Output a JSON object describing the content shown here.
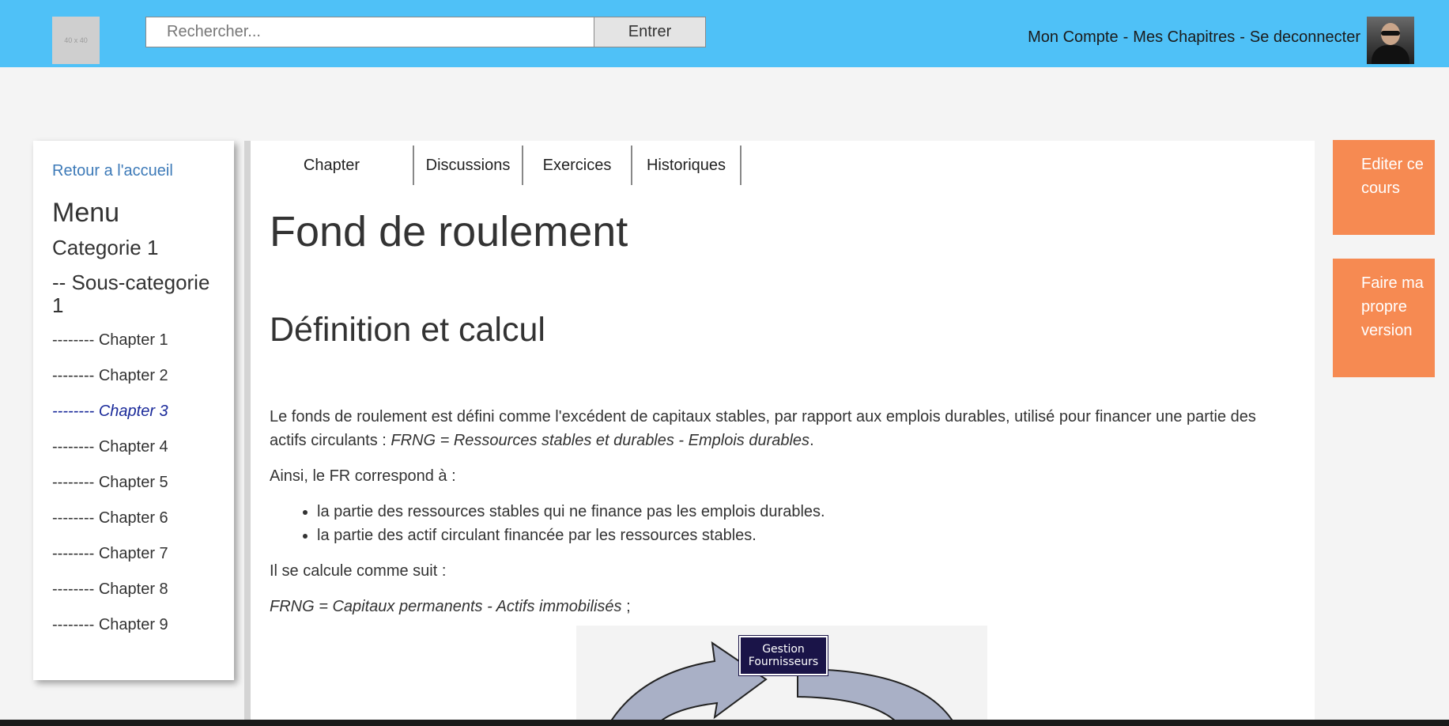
{
  "header": {
    "logo_text": "40 x 40",
    "search_placeholder": "Rechercher...",
    "search_button": "Entrer",
    "account": "Mon Compte",
    "separator": "-",
    "chapters": "Mes Chapitres",
    "logout": "Se deconnecter"
  },
  "sidebar": {
    "back": "Retour a l'accueil",
    "menu_title": "Menu",
    "category": "Categorie 1",
    "subcategory": "-- Sous-categorie 1",
    "chapters": [
      "-------- Chapter 1",
      "-------- Chapter 2",
      "-------- Chapter 3",
      "-------- Chapter 4",
      "-------- Chapter 5",
      "-------- Chapter 6",
      "-------- Chapter 7",
      "-------- Chapter 8",
      "-------- Chapter 9"
    ],
    "active_chapter": "-------- Chapter 3"
  },
  "tabs": [
    "Chapter",
    "Discussions",
    "Exercices",
    "Historiques"
  ],
  "content": {
    "title": "Fond de roulement",
    "section_title": "Définition et calcul",
    "para1_text": "Le fonds de roulement est défini comme l'excédent de capitaux stables, par rapport aux emplois durables, utilisé pour financer une partie des actifs circulants : ",
    "para1_formula": "FRNG = Ressources stables et durables - Emplois durables",
    "para1_end": ".",
    "para2": "Ainsi, le FR correspond à :",
    "bullets": [
      "la partie des ressources stables qui ne finance pas les emplois durables.",
      "la partie des actif circulant financée par les ressources stables."
    ],
    "para3": "Il se calcule comme suit :",
    "formula": "FRNG = Capitaux permanents - Actifs immobilisés",
    "formula_end": " ;",
    "diagram_box_line1": "Gestion",
    "diagram_box_line2": "Fournisseurs"
  },
  "actions": {
    "edit": "Editer ce cours",
    "own_version": "Faire ma propre version"
  },
  "colors": {
    "header_bg": "#4fc1f7",
    "action_bg": "#f68a52",
    "link": "#3d7ab8",
    "active_chapter": "#1a2a9a"
  }
}
